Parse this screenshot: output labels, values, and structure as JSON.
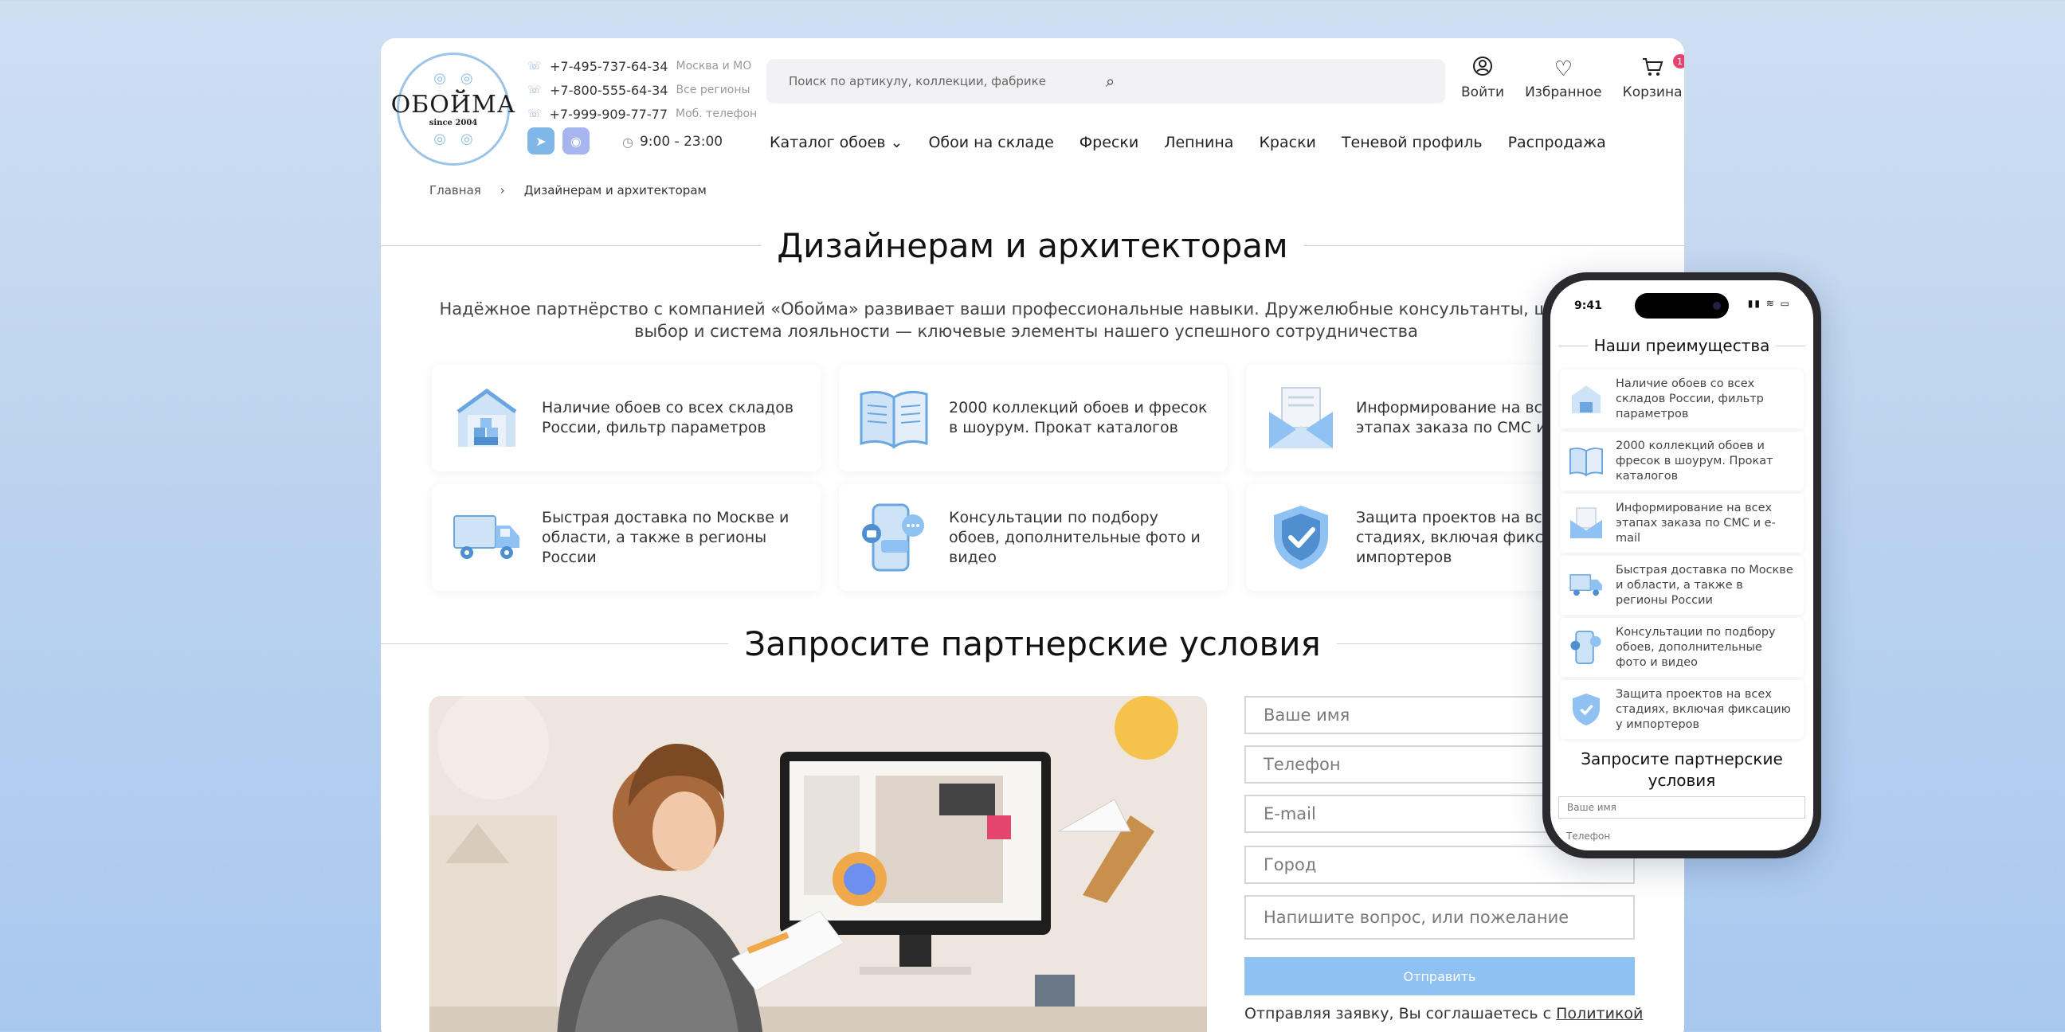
{
  "logo": {
    "word": "ОБОЙМА",
    "since": "since 2004"
  },
  "phones": [
    {
      "number": "+7-495-737-64-34",
      "note": "Москва и МО"
    },
    {
      "number": "+7-800-555-64-34",
      "note": "Все регионы"
    },
    {
      "number": "+7-999-909-77-77",
      "note": "Моб. телефон"
    }
  ],
  "hours": "9:00 - 23:00",
  "search": {
    "placeholder": "Поиск по артикулу, коллекции, фабрике"
  },
  "header_actions": {
    "login": "Войти",
    "favorites": "Избранное",
    "cart": "Корзина",
    "cart_count": "1"
  },
  "nav": [
    "Каталог обоев",
    "Обои на складе",
    "Фрески",
    "Лепнина",
    "Краски",
    "Теневой профиль",
    "Распродажа"
  ],
  "breadcrumbs": {
    "home": "Главная",
    "current": "Дизайнерам и архитекторам"
  },
  "page_title": "Дизайнерам и архитекторам",
  "intro": "Надёжное партнёрство с компанией «Обойма» развивает ваши профессиональные навыки. Дружелюбные консультанты, широкий выбор и система лояльности — ключевые элементы нашего успешного сотрудничества",
  "features": [
    {
      "icon": "warehouse-icon",
      "text": "Наличие обоев со всех складов России, фильтр параметров"
    },
    {
      "icon": "catalog-book-icon",
      "text": "2000 коллекций обоев и фресок в шоурум. Прокат каталогов"
    },
    {
      "icon": "envelope-icon",
      "text": "Информирование на всех этапах заказа по СМС и e-mail"
    },
    {
      "icon": "delivery-truck-icon",
      "text": "Быстрая доставка по Москве и области, а также в регионы России"
    },
    {
      "icon": "smartphone-chat-icon",
      "text": "Консультации по подбору обоев, дополнительные фото и видео"
    },
    {
      "icon": "shield-check-icon",
      "text": "Защита проектов на всех стадиях, включая фиксацию у импортеров"
    }
  ],
  "request_title": "Запросите партнерские условия",
  "form": {
    "name": "Ваше имя",
    "phone": "Телефон",
    "email": "E-mail",
    "city": "Город",
    "question": "Напишите вопрос, или пожелание",
    "submit": "Отправить",
    "agree_text": "Отправляя заявку, Вы соглашаетесь с",
    "agree_link": "Политикой"
  },
  "mobile": {
    "time": "9:41",
    "advantages_title": "Наши преимущества",
    "items": [
      "Наличие обоев со всех складов России, фильтр параметров",
      "2000 коллекций обоев и фресок в шоурум. Прокат каталогов",
      "Информирование на всех этапах заказа по СМС и e-mail",
      "Быстрая доставка по Москве и области, а также в регионы России",
      "Консультации по подбору обоев, дополнительные фото и видео",
      "Защита проектов на всех стадиях, включая фиксацию у импортеров"
    ],
    "request_title": "Запросите партнерские условия",
    "name_placeholder": "Ваше имя",
    "phone_placeholder": "Телефон"
  },
  "colors": {
    "accent": "#8fc2f2",
    "badge": "#e4456f",
    "background": "#bcd3ef"
  }
}
